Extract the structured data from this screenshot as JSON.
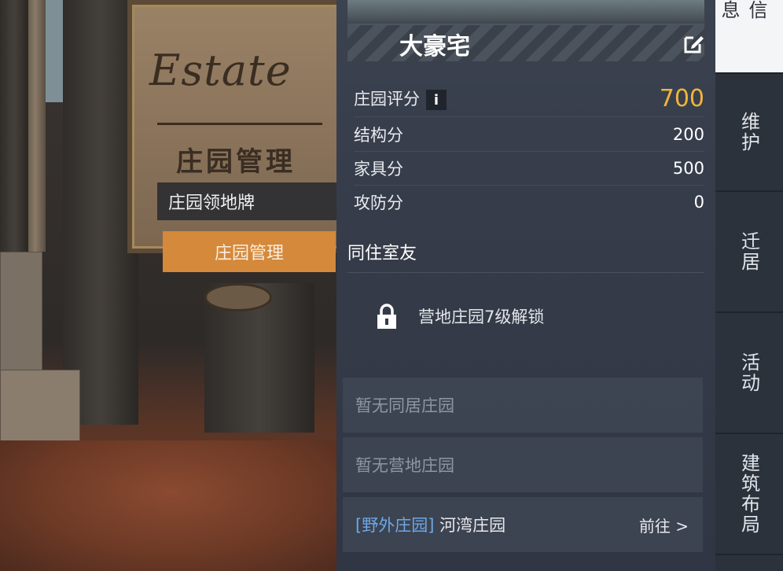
{
  "scene": {
    "sign_script": "Estate",
    "sign_cn": "庄园管理",
    "popup_label": "庄园领地牌",
    "popup_button": "庄园管理"
  },
  "panel": {
    "title": "大豪宅",
    "edit_icon": "edit-icon",
    "score": {
      "label": "庄园评分",
      "info": "i",
      "value": "700"
    },
    "stats": [
      {
        "label": "结构分",
        "value": "200"
      },
      {
        "label": "家具分",
        "value": "500"
      },
      {
        "label": "攻防分",
        "value": "0"
      }
    ],
    "roommates_title": "同住室友",
    "lock_text": "营地庄园7级解锁",
    "no_cohabit": "暂无同居庄园",
    "no_camp": "暂无营地庄园",
    "wild_tag": "[野外庄园]",
    "wild_name": "河湾庄园",
    "goto": "前往 >"
  },
  "tabs": [
    "信息",
    "维护",
    "迁居",
    "活动",
    "建筑布局"
  ],
  "colors": {
    "accent_orange": "#d4893b",
    "score_gold": "#f0b43a",
    "tag_blue": "#6ea8e6"
  }
}
